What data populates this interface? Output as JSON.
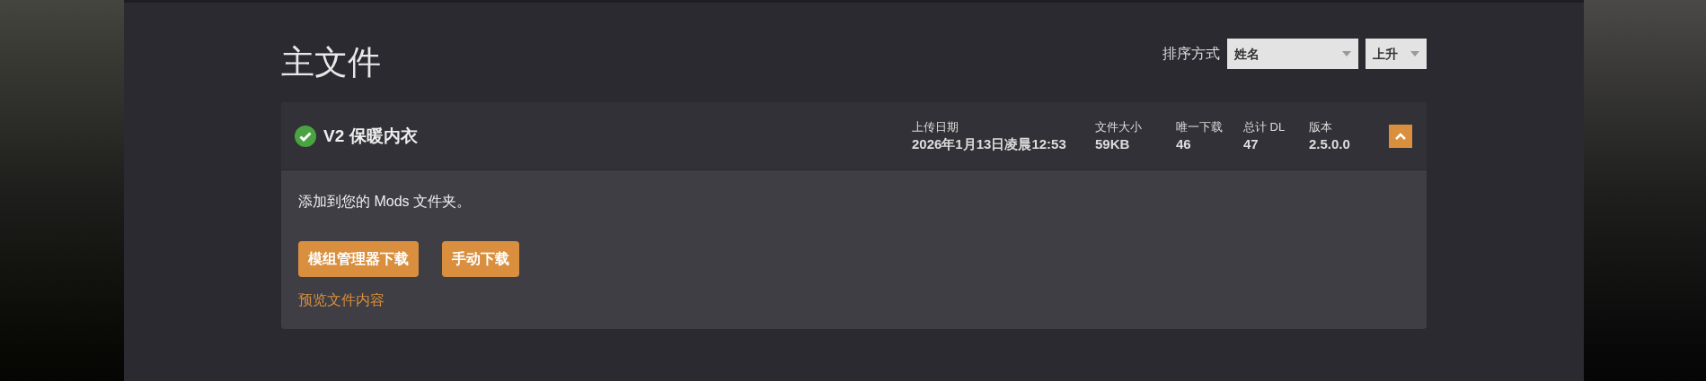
{
  "heading": "主文件",
  "sort": {
    "label": "排序方式",
    "field": "姓名",
    "order": "上升"
  },
  "files": [
    {
      "verified": true,
      "title": "V2 保暖内衣",
      "expanded": true,
      "stats": [
        {
          "label": "上传日期",
          "value": "2026年1月13日凌晨12:53"
        },
        {
          "label": "文件大小",
          "value": "59KB"
        },
        {
          "label": "唯一下载",
          "value": "46"
        },
        {
          "label": "总计 DL",
          "value": "47"
        },
        {
          "label": "版本",
          "value": "2.5.0.0"
        }
      ],
      "description": "添加到您的 Mods 文件夹。",
      "buttons": [
        "模组管理器下载",
        "手动下载"
      ],
      "preview_link": "预览文件内容"
    }
  ]
}
